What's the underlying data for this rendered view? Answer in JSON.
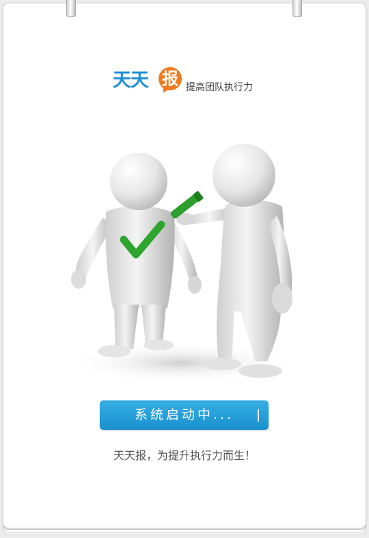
{
  "logo": {
    "word": "天天",
    "bubble_char": "报",
    "slogan": "提高团队执行力"
  },
  "status": {
    "label": "系统启动中..."
  },
  "tagline": "天天报，为提升执行力而生！",
  "colors": {
    "brand_blue": "#1e8fd8",
    "brand_orange": "#f07a1c",
    "button_blue": "#2aa3dc",
    "check_green": "#2ea52f"
  },
  "illustration": {
    "icon": "two-figures-checkmark-illustration"
  }
}
